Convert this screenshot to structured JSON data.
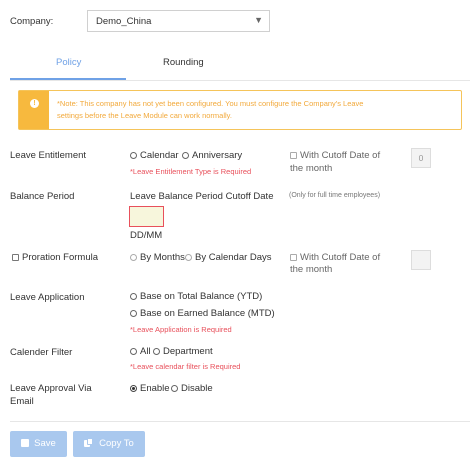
{
  "company": {
    "label": "Company:",
    "selected": "Demo_China"
  },
  "tabs": [
    {
      "label": "Policy",
      "active": true
    },
    {
      "label": "Rounding",
      "active": false
    }
  ],
  "alert": {
    "icon": "info-icon",
    "line1": "*Note: This company has not yet been configured. You must configure the Company's Leave",
    "line2": "settings before the Leave Module can work normally."
  },
  "leave_entitlement": {
    "label": "Leave Entitlement",
    "options": [
      "Calendar",
      "Anniversary"
    ],
    "error": "*Leave Entitlement Type is Required",
    "cutoff_line1": "With Cutoff Date of",
    "cutoff_line2": "the month",
    "cutoff_value": "0"
  },
  "balance_period": {
    "label": "Balance Period",
    "cutoff_label": "Leave Balance Period Cutoff Date",
    "hint": "(Only for full time employees)",
    "format": "DD/MM"
  },
  "proration": {
    "label": "Proration Formula",
    "options": [
      "By Months",
      "By Calendar Days"
    ],
    "cutoff_line1": "With Cutoff Date of",
    "cutoff_line2": "the month"
  },
  "leave_application": {
    "label": "Leave Application",
    "options": [
      "Base on Total Balance (YTD)",
      "Base on Earned Balance (MTD)"
    ],
    "error": "*Leave Application is Required"
  },
  "calendar_filter": {
    "label": "Calender Filter",
    "options": [
      "All",
      "Department"
    ],
    "error": "*Leave calendar filter is Required"
  },
  "approval_email": {
    "label_line1": "Leave Approval Via",
    "label_line2": "Email",
    "options": [
      "Enable",
      "Disable"
    ]
  },
  "buttons": {
    "save": "Save",
    "copy_to": "Copy To"
  },
  "colors": {
    "accent": "#6fa1e6",
    "button": "#a9c8ee",
    "error": "#e8505b",
    "alert_border": "#f5c45a"
  }
}
